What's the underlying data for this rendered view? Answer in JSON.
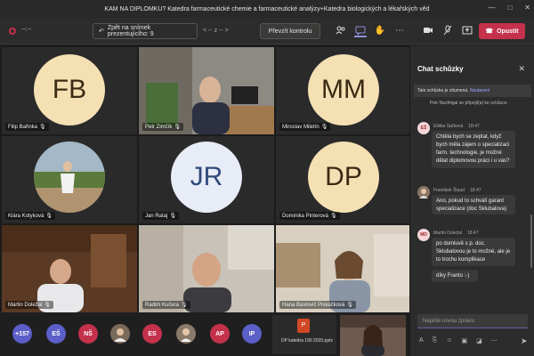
{
  "window": {
    "title": "KAM NA DIPLOMKU? Katedra farmaceutické chemie a farmaceutické analýzy+Katedra biologických a lékařských věd",
    "minimize": "—",
    "maximize": "□",
    "close": "✕"
  },
  "toolbar": {
    "timer": "--:--",
    "back_label": "Zpět na snímek prezentujícího: 9",
    "slide_nav": "< -- z -- >",
    "take_control_label": "Převzít kontrolu",
    "leave_label": "Opustit",
    "icons": [
      "people-icon",
      "chat-icon",
      "raise-hand-icon",
      "more-icon",
      "camera-icon",
      "mic-icon",
      "share-icon",
      "phone-icon"
    ]
  },
  "tiles": [
    {
      "name": "Filip Bařinka",
      "initials": "FB",
      "type": "avatar"
    },
    {
      "name": "Petr Zimčík",
      "type": "video"
    },
    {
      "name": "Miroslav Miletín",
      "initials": "MM",
      "type": "avatar"
    },
    {
      "name": "Klára Kotyková",
      "type": "photo"
    },
    {
      "name": "Jan Rataj",
      "initials": "JR",
      "type": "avatar"
    },
    {
      "name": "Dominika Pinterová",
      "initials": "DP",
      "type": "avatar"
    },
    {
      "name": "Martin Doležal",
      "type": "video"
    },
    {
      "name": "Radim Kučera",
      "type": "video"
    },
    {
      "name": "Hana Bavlovič Piskáčková",
      "type": "video"
    }
  ],
  "strip": {
    "overflow_count": "+157",
    "chips": [
      {
        "label": "EŠ",
        "color": "#5b5fc7"
      },
      {
        "label": "NŠ",
        "color": "#c4314b"
      },
      {
        "label": "",
        "color": "#7a6a5a",
        "photo": true
      },
      {
        "label": "ES",
        "color": "#c4314b"
      },
      {
        "label": "",
        "color": "#8a7a6a",
        "photo": true
      },
      {
        "label": "AP",
        "color": "#c4314b"
      },
      {
        "label": "IP",
        "color": "#5b5fc7"
      }
    ],
    "file_name": "DP katedra 190 2020.pptx",
    "file_icon": "P"
  },
  "chat": {
    "title": "Chat schůzky",
    "close": "✕",
    "banner_text": "Tato schůzka je ztlumená.",
    "banner_link": "Nastavení",
    "system_message": "Petr Nachtigal se připojil(a) ke schůzce.",
    "messages": [
      {
        "author": "Eliška Saťková",
        "time": "18:47",
        "initials": "EŠ",
        "text": "Chtěla bych se zeptat, když bych měla zájem o specializaci farm. technologie, je možné dělat diplomovou práci i u vás?"
      },
      {
        "author": "František Štaud",
        "time": "18:47",
        "initials": "",
        "text": "Ano, pokud to schválí garant specializace (doc Sklubalova)"
      },
      {
        "author": "Martin Doležal",
        "time": "18:47",
        "initials": "MD",
        "text": "po domluvě s p. doc. Sklubalovou je to možné, ale je to trochu komplikace"
      },
      {
        "author": "",
        "time": "",
        "initials": "",
        "text": "díky Franto :-)"
      }
    ],
    "compose_placeholder": "Napište novou zprávu",
    "compose_icons": [
      "format-icon",
      "attach-icon",
      "emoji-icon",
      "gif-icon",
      "sticker-icon",
      "more-icon"
    ],
    "send_icon": "send-icon"
  }
}
